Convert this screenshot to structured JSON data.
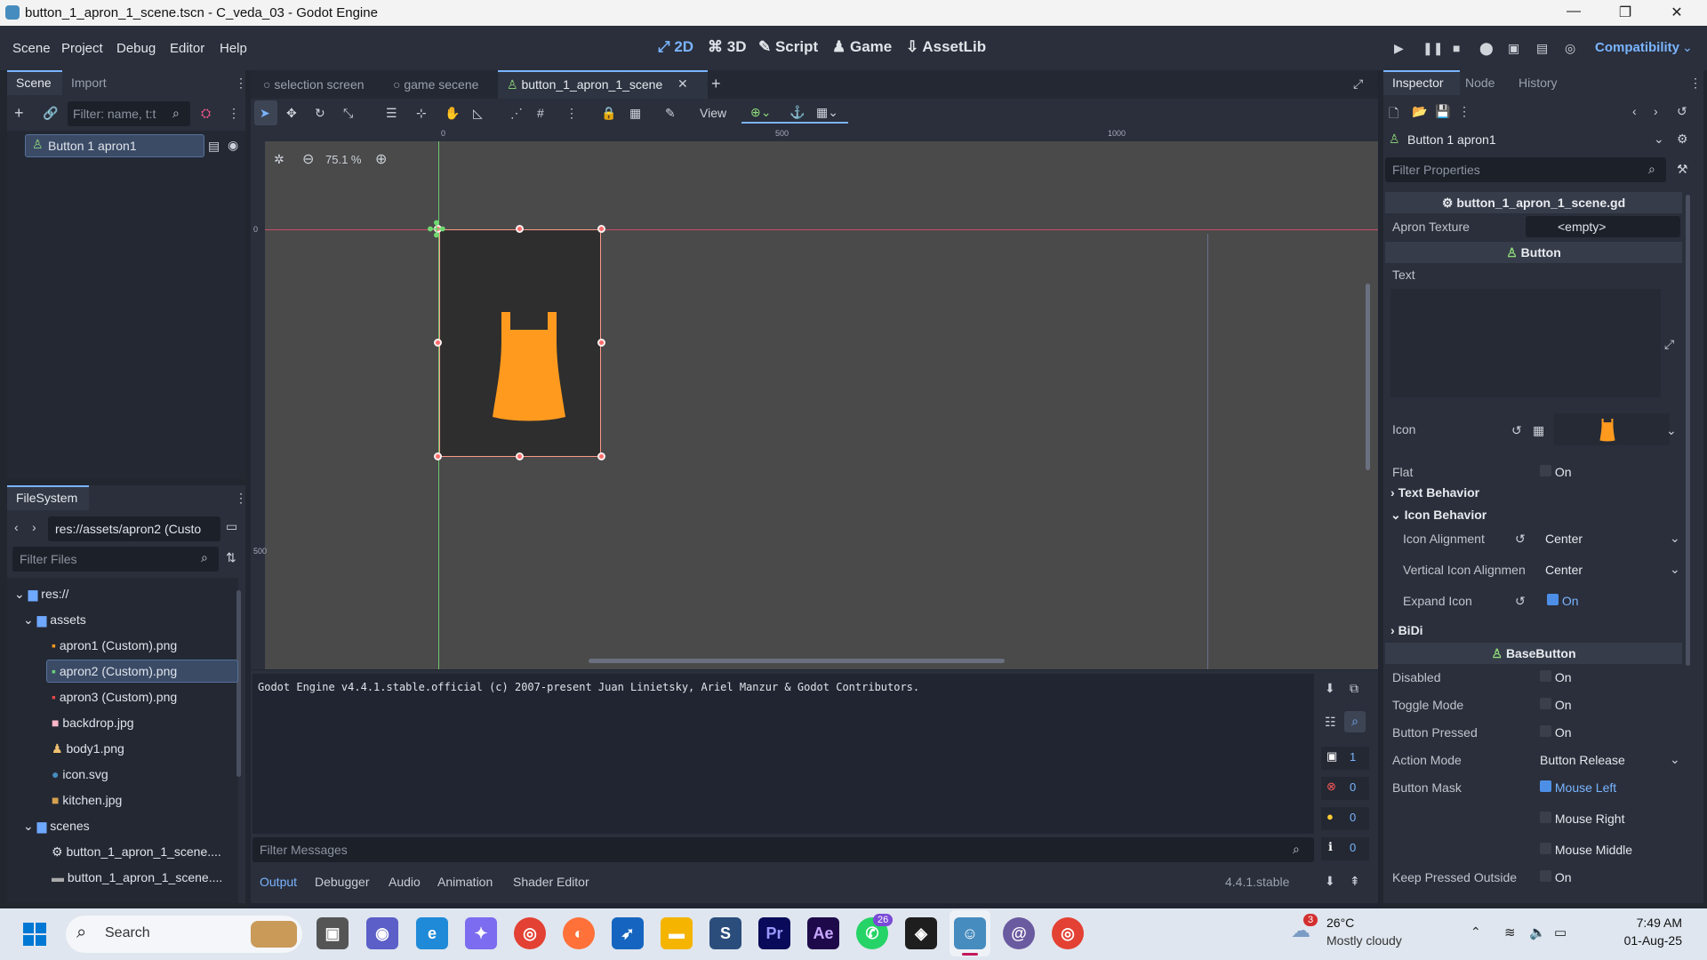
{
  "window": {
    "title": "button_1_apron_1_scene.tscn - C_veda_03 - Godot Engine"
  },
  "menu": [
    "Scene",
    "Project",
    "Debug",
    "Editor",
    "Help"
  ],
  "workspaces": [
    "2D",
    "3D",
    "Script",
    "Game",
    "AssetLib"
  ],
  "renderer": "Compatibility",
  "scene_dock": {
    "tabs": [
      "Scene",
      "Import"
    ],
    "filter_placeholder": "Filter: name, t:t",
    "root_node": "Button 1 apron1"
  },
  "filesystem": {
    "tab": "FileSystem",
    "path": "res://assets/apron2 (Custo",
    "filter_placeholder": "Filter Files",
    "items": [
      "res://",
      "assets",
      "apron1 (Custom).png",
      "apron2 (Custom).png",
      "apron3 (Custom).png",
      "backdrop.jpg",
      "body1.png",
      "icon.svg",
      "kitchen.jpg",
      "scenes",
      "button_1_apron_1_scene....",
      "button_1_apron_1_scene...."
    ]
  },
  "scene_tabs": [
    "selection screen",
    "game secene",
    "button_1_apron_1_scene"
  ],
  "toolbar": {
    "view": "View"
  },
  "canvas": {
    "zoom": "75.1 %",
    "ruler": [
      "0",
      "500",
      "1000"
    ],
    "vruler": [
      "0",
      "500"
    ]
  },
  "output": {
    "log": "Godot Engine v4.4.1.stable.official (c) 2007-present Juan Linietsky, Ariel Manzur & Godot Contributors.",
    "filter_placeholder": "Filter Messages",
    "counts": [
      "1",
      "0",
      "0",
      "0"
    ],
    "tabs": [
      "Output",
      "Debugger",
      "Audio",
      "Animation",
      "Shader Editor"
    ],
    "version": "4.4.1.stable"
  },
  "inspector": {
    "tabs": [
      "Inspector",
      "Node",
      "History"
    ],
    "node": "Button 1 apron1",
    "filter_placeholder": "Filter Properties",
    "script": "button_1_apron_1_scene.gd",
    "apron_texture_label": "Apron Texture",
    "apron_texture_value": "<empty>",
    "button_section": "Button",
    "text_label": "Text",
    "icon_label": "Icon",
    "flat_label": "Flat",
    "on": "On",
    "text_behavior": "Text Behavior",
    "icon_behavior": "Icon Behavior",
    "icon_alignment_label": "Icon Alignment",
    "icon_alignment_value": "Center",
    "vicon_label": "Vertical Icon Alignmen",
    "vicon_value": "Center",
    "expand_icon_label": "Expand Icon",
    "bidi": "BiDi",
    "basebutton": "BaseButton",
    "disabled": "Disabled",
    "toggle_mode": "Toggle Mode",
    "button_pressed": "Button Pressed",
    "action_mode_label": "Action Mode",
    "action_mode_value": "Button Release",
    "button_mask_label": "Button Mask",
    "mask_left": "Mouse Left",
    "mask_right": "Mouse Right",
    "mask_middle": "Mouse Middle",
    "keep_pressed": "Keep Pressed Outside"
  },
  "taskbar": {
    "search": "Search",
    "whatsapp_badge": "26",
    "weather_badge": "3",
    "temp": "26°C",
    "weather": "Mostly cloudy",
    "time": "7:49 AM",
    "date": "01-Aug-25"
  },
  "colors": {
    "accent": "#7ab4ff",
    "apron": "#ff9a1f",
    "guide": "#c9506a"
  }
}
